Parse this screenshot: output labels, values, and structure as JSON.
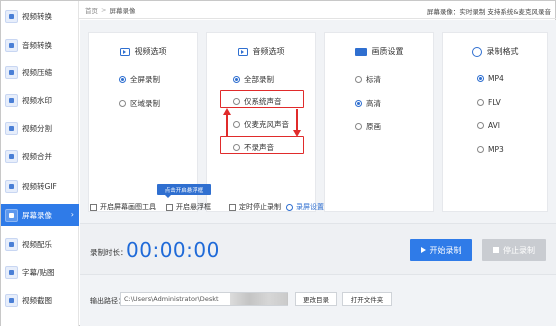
{
  "sidebar": {
    "items": [
      {
        "label": "视频转换",
        "icon": "video-convert-icon"
      },
      {
        "label": "音频转换",
        "icon": "audio-convert-icon"
      },
      {
        "label": "视频压缩",
        "icon": "video-compress-icon"
      },
      {
        "label": "视频水印",
        "icon": "video-watermark-icon"
      },
      {
        "label": "视频分割",
        "icon": "video-split-icon"
      },
      {
        "label": "视频合并",
        "icon": "video-merge-icon"
      },
      {
        "label": "视频转GIF",
        "icon": "video-gif-icon"
      },
      {
        "label": "屏幕录像",
        "icon": "screen-record-icon",
        "active": true
      },
      {
        "label": "视频配乐",
        "icon": "video-music-icon"
      },
      {
        "label": "字幕/贴图",
        "icon": "subtitle-icon"
      },
      {
        "label": "视频截图",
        "icon": "video-screenshot-icon"
      }
    ]
  },
  "header": {
    "breadcrumb_home": "首页",
    "breadcrumb_sep": ">",
    "breadcrumb_current": "屏幕录像",
    "tip": "屏幕录像：实时录制 支持系统&麦克风录音"
  },
  "cards": {
    "video": {
      "title": "视频选项",
      "options": [
        "全屏录制",
        "区域录制"
      ],
      "selected": 0
    },
    "audio": {
      "title": "音频选项",
      "options": [
        "全部录制",
        "仅系统声音",
        "仅麦克风声音",
        "不录声音"
      ],
      "selected": 0
    },
    "quality": {
      "title": "画质设置",
      "options": [
        "标清",
        "高清",
        "原画"
      ],
      "selected": 1
    },
    "format": {
      "title": "录制格式",
      "options": [
        "MP4",
        "FLV",
        "AVI",
        "MP3"
      ],
      "selected": 0
    }
  },
  "checkboxes": {
    "items": [
      "开启屏幕画图工具",
      "开启悬浮框",
      "定时停止录制"
    ],
    "settings_link": "录屏设置",
    "tooltip": "点击开启悬浮框"
  },
  "timer": {
    "label": "录制时长：",
    "value": "00:00:00",
    "start_label": "开始录制",
    "stop_label": "停止录制"
  },
  "output": {
    "label": "输出路径：",
    "path": "C:\\Users\\Administrator\\Deskt",
    "change_dir": "更改目录",
    "open_folder": "打开文件夹"
  },
  "colors": {
    "accent": "#2f7be8",
    "annotation_red": "#e02b2b",
    "timer_blue": "#1f6ad8"
  }
}
